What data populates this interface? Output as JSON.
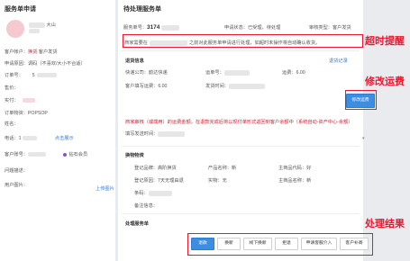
{
  "left": {
    "title": "服务单申请",
    "user_suffix": "大山",
    "label_customer": "客户帐户：",
    "customer_value": "换货",
    "customer_tag": "客户发货",
    "label_reason": "申请原因：",
    "reason_value": "调码（不喜欢/大小不合适）",
    "label_order": "订单号：",
    "order_value": "5",
    "label_price": "售价：",
    "label_paid": "实付：",
    "label_product": "订单物资：",
    "product_value": "POPSOP",
    "label_name": "姓名：",
    "label_phone": "电话：",
    "phone_value": "1",
    "phone_link": "点击展示",
    "label_account": "客户账号：",
    "account_badge": "钻石会员",
    "label_question": "问题描述：",
    "label_images": "用户图片：",
    "images_link": "上传图片"
  },
  "right": {
    "title": "待处理服务单",
    "label_service_no": "服务单号：",
    "service_no": "3174",
    "label_status": "申请状态：",
    "status_value": "已受理，待处理",
    "label_audit": "审核类型：",
    "audit_value": "客户发货",
    "notice_prefix": "商家需要在",
    "notice_suffix": "之前对此服务单申请进行处理，如超时未操作将自动确认收货。",
    "logistics_title": "退货信息",
    "logistics_link": "退货记录",
    "label_express": "快递公司：",
    "express_value": "韵达快递",
    "label_tracking": "运单号：",
    "label_freight1": "运费：",
    "freight1_value": "6.00",
    "label_customer_freight": "客户填写运费：",
    "customer_freight_value": "6.00",
    "label_ship_time": "发货时间：",
    "modify_button": "修改运费",
    "warning": "商家审核（或端用）的运费金额，在退款完成后将以现付单形式返回到客户余额中（系统自动-资产中心-余额）",
    "label_fill_time": "填写发送时间：",
    "product_title": "换物物资",
    "label_brand": "登记品牌：",
    "brand_value": "高阶换货",
    "label_prod_name": "产品名称：",
    "prod_name_value": "新",
    "label_main_code": "主商品代码：",
    "main_code_value": "好",
    "label_reg_reason": "登记原因：",
    "reg_reason_value": "7天无理由退",
    "label_spec": "实物：",
    "spec_value": "无",
    "label_main_name": "主商品名称：",
    "main_name_value": "新",
    "label_sku": "条码：",
    "label_remark": "备注信息：",
    "handle_title": "处理服务单",
    "buttons": [
      "退款",
      "换新",
      "线下换新",
      "拒退",
      "申请客服介入",
      "客户补寄"
    ]
  },
  "annotations": {
    "timeout": "超时提醒",
    "modify_freight": "修改运费",
    "handle_result": "处理结果"
  },
  "colors": {
    "annotation_red": "#f0142d",
    "primary_blue": "#3c8ee3"
  }
}
